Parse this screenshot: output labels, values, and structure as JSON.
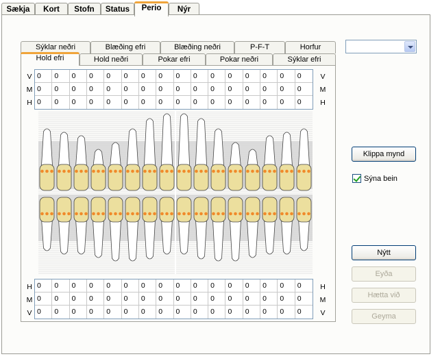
{
  "top_tabs": [
    {
      "label": "Sækja",
      "active": false
    },
    {
      "label": "Kort",
      "active": false
    },
    {
      "label": "Stofn",
      "active": false
    },
    {
      "label": "Status",
      "active": false
    },
    {
      "label": "Perio",
      "active": true
    },
    {
      "label": "Nýr",
      "active": false
    }
  ],
  "sub_tabs_row1": [
    "Sýklar neðri",
    "Blæðing efri",
    "Blæðing neðri",
    "P-F-T",
    "Horfur"
  ],
  "sub_tabs_row2": [
    "Hold efri",
    "Hold neðri",
    "Pokar efri",
    "Pokar neðri",
    "Sýklar efri"
  ],
  "active_sub_tab": "Hold efri",
  "upper_grid": {
    "labels_left": [
      "V",
      "M",
      "H"
    ],
    "labels_right": [
      "V",
      "M",
      "H"
    ],
    "rows": [
      [
        "0",
        "0",
        "0",
        "0",
        "0",
        "0",
        "0",
        "0",
        "0",
        "0",
        "0",
        "0",
        "0",
        "0",
        "0",
        "0"
      ],
      [
        "0",
        "0",
        "0",
        "0",
        "0",
        "0",
        "0",
        "0",
        "0",
        "0",
        "0",
        "0",
        "0",
        "0",
        "0",
        "0"
      ],
      [
        "0",
        "0",
        "0",
        "0",
        "0",
        "0",
        "0",
        "0",
        "0",
        "0",
        "0",
        "0",
        "0",
        "0",
        "0",
        "0"
      ]
    ]
  },
  "lower_grid": {
    "labels_left": [
      "H",
      "M",
      "V"
    ],
    "labels_right": [
      "H",
      "M",
      "V"
    ],
    "rows": [
      [
        "0",
        "0",
        "0",
        "0",
        "0",
        "0",
        "0",
        "0",
        "0",
        "0",
        "0",
        "0",
        "0",
        "0",
        "0",
        "0"
      ],
      [
        "0",
        "0",
        "0",
        "0",
        "0",
        "0",
        "0",
        "0",
        "0",
        "0",
        "0",
        "0",
        "0",
        "0",
        "0",
        "0"
      ],
      [
        "0",
        "0",
        "0",
        "0",
        "0",
        "0",
        "0",
        "0",
        "0",
        "0",
        "0",
        "0",
        "0",
        "0",
        "0",
        "0"
      ]
    ]
  },
  "dropdown": {
    "value": ""
  },
  "buttons": {
    "clip_image": "Klippa mynd",
    "new": "Nýtt",
    "delete": "Eyða",
    "cancel": "Hætta við",
    "save": "Geyma"
  },
  "show_bone": {
    "label": "Sýna bein",
    "checked": true
  },
  "colors": {
    "tab_accent": "#f0a43a",
    "tooth_crown": "#ecdf9e",
    "tooth_root": "#ffffff",
    "measure_dot": "#f08a2a",
    "bone_band": "#d6d6d6"
  }
}
